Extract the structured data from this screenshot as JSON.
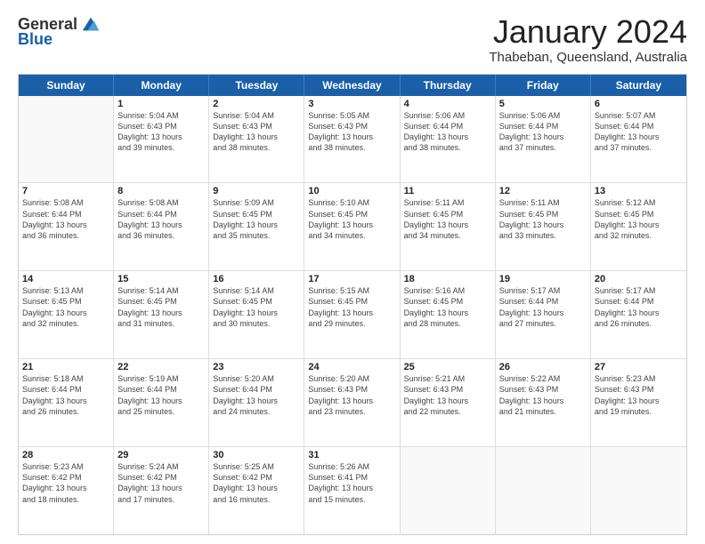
{
  "logo": {
    "general": "General",
    "blue": "Blue"
  },
  "header": {
    "month": "January 2024",
    "location": "Thabeban, Queensland, Australia"
  },
  "weekdays": [
    "Sunday",
    "Monday",
    "Tuesday",
    "Wednesday",
    "Thursday",
    "Friday",
    "Saturday"
  ],
  "rows": [
    [
      {
        "day": "",
        "lines": []
      },
      {
        "day": "1",
        "lines": [
          "Sunrise: 5:04 AM",
          "Sunset: 6:43 PM",
          "Daylight: 13 hours",
          "and 39 minutes."
        ]
      },
      {
        "day": "2",
        "lines": [
          "Sunrise: 5:04 AM",
          "Sunset: 6:43 PM",
          "Daylight: 13 hours",
          "and 38 minutes."
        ]
      },
      {
        "day": "3",
        "lines": [
          "Sunrise: 5:05 AM",
          "Sunset: 6:43 PM",
          "Daylight: 13 hours",
          "and 38 minutes."
        ]
      },
      {
        "day": "4",
        "lines": [
          "Sunrise: 5:06 AM",
          "Sunset: 6:44 PM",
          "Daylight: 13 hours",
          "and 38 minutes."
        ]
      },
      {
        "day": "5",
        "lines": [
          "Sunrise: 5:06 AM",
          "Sunset: 6:44 PM",
          "Daylight: 13 hours",
          "and 37 minutes."
        ]
      },
      {
        "day": "6",
        "lines": [
          "Sunrise: 5:07 AM",
          "Sunset: 6:44 PM",
          "Daylight: 13 hours",
          "and 37 minutes."
        ]
      }
    ],
    [
      {
        "day": "7",
        "lines": [
          "Sunrise: 5:08 AM",
          "Sunset: 6:44 PM",
          "Daylight: 13 hours",
          "and 36 minutes."
        ]
      },
      {
        "day": "8",
        "lines": [
          "Sunrise: 5:08 AM",
          "Sunset: 6:44 PM",
          "Daylight: 13 hours",
          "and 36 minutes."
        ]
      },
      {
        "day": "9",
        "lines": [
          "Sunrise: 5:09 AM",
          "Sunset: 6:45 PM",
          "Daylight: 13 hours",
          "and 35 minutes."
        ]
      },
      {
        "day": "10",
        "lines": [
          "Sunrise: 5:10 AM",
          "Sunset: 6:45 PM",
          "Daylight: 13 hours",
          "and 34 minutes."
        ]
      },
      {
        "day": "11",
        "lines": [
          "Sunrise: 5:11 AM",
          "Sunset: 6:45 PM",
          "Daylight: 13 hours",
          "and 34 minutes."
        ]
      },
      {
        "day": "12",
        "lines": [
          "Sunrise: 5:11 AM",
          "Sunset: 6:45 PM",
          "Daylight: 13 hours",
          "and 33 minutes."
        ]
      },
      {
        "day": "13",
        "lines": [
          "Sunrise: 5:12 AM",
          "Sunset: 6:45 PM",
          "Daylight: 13 hours",
          "and 32 minutes."
        ]
      }
    ],
    [
      {
        "day": "14",
        "lines": [
          "Sunrise: 5:13 AM",
          "Sunset: 6:45 PM",
          "Daylight: 13 hours",
          "and 32 minutes."
        ]
      },
      {
        "day": "15",
        "lines": [
          "Sunrise: 5:14 AM",
          "Sunset: 6:45 PM",
          "Daylight: 13 hours",
          "and 31 minutes."
        ]
      },
      {
        "day": "16",
        "lines": [
          "Sunrise: 5:14 AM",
          "Sunset: 6:45 PM",
          "Daylight: 13 hours",
          "and 30 minutes."
        ]
      },
      {
        "day": "17",
        "lines": [
          "Sunrise: 5:15 AM",
          "Sunset: 6:45 PM",
          "Daylight: 13 hours",
          "and 29 minutes."
        ]
      },
      {
        "day": "18",
        "lines": [
          "Sunrise: 5:16 AM",
          "Sunset: 6:45 PM",
          "Daylight: 13 hours",
          "and 28 minutes."
        ]
      },
      {
        "day": "19",
        "lines": [
          "Sunrise: 5:17 AM",
          "Sunset: 6:44 PM",
          "Daylight: 13 hours",
          "and 27 minutes."
        ]
      },
      {
        "day": "20",
        "lines": [
          "Sunrise: 5:17 AM",
          "Sunset: 6:44 PM",
          "Daylight: 13 hours",
          "and 26 minutes."
        ]
      }
    ],
    [
      {
        "day": "21",
        "lines": [
          "Sunrise: 5:18 AM",
          "Sunset: 6:44 PM",
          "Daylight: 13 hours",
          "and 26 minutes."
        ]
      },
      {
        "day": "22",
        "lines": [
          "Sunrise: 5:19 AM",
          "Sunset: 6:44 PM",
          "Daylight: 13 hours",
          "and 25 minutes."
        ]
      },
      {
        "day": "23",
        "lines": [
          "Sunrise: 5:20 AM",
          "Sunset: 6:44 PM",
          "Daylight: 13 hours",
          "and 24 minutes."
        ]
      },
      {
        "day": "24",
        "lines": [
          "Sunrise: 5:20 AM",
          "Sunset: 6:43 PM",
          "Daylight: 13 hours",
          "and 23 minutes."
        ]
      },
      {
        "day": "25",
        "lines": [
          "Sunrise: 5:21 AM",
          "Sunset: 6:43 PM",
          "Daylight: 13 hours",
          "and 22 minutes."
        ]
      },
      {
        "day": "26",
        "lines": [
          "Sunrise: 5:22 AM",
          "Sunset: 6:43 PM",
          "Daylight: 13 hours",
          "and 21 minutes."
        ]
      },
      {
        "day": "27",
        "lines": [
          "Sunrise: 5:23 AM",
          "Sunset: 6:43 PM",
          "Daylight: 13 hours",
          "and 19 minutes."
        ]
      }
    ],
    [
      {
        "day": "28",
        "lines": [
          "Sunrise: 5:23 AM",
          "Sunset: 6:42 PM",
          "Daylight: 13 hours",
          "and 18 minutes."
        ]
      },
      {
        "day": "29",
        "lines": [
          "Sunrise: 5:24 AM",
          "Sunset: 6:42 PM",
          "Daylight: 13 hours",
          "and 17 minutes."
        ]
      },
      {
        "day": "30",
        "lines": [
          "Sunrise: 5:25 AM",
          "Sunset: 6:42 PM",
          "Daylight: 13 hours",
          "and 16 minutes."
        ]
      },
      {
        "day": "31",
        "lines": [
          "Sunrise: 5:26 AM",
          "Sunset: 6:41 PM",
          "Daylight: 13 hours",
          "and 15 minutes."
        ]
      },
      {
        "day": "",
        "lines": []
      },
      {
        "day": "",
        "lines": []
      },
      {
        "day": "",
        "lines": []
      }
    ]
  ]
}
